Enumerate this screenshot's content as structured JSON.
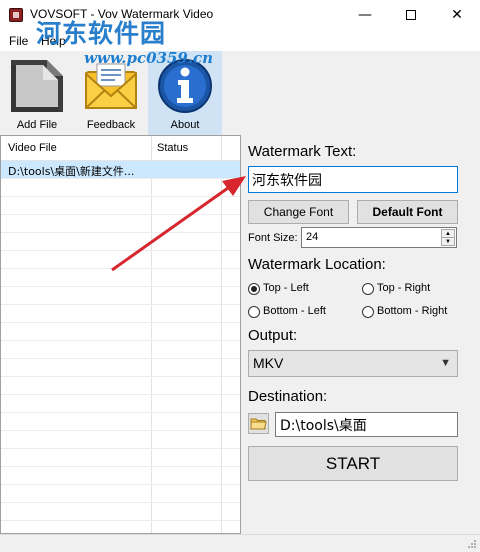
{
  "window": {
    "title": "VOVSOFT - Vov Watermark Video",
    "minimize_glyph": "—",
    "close_glyph": "✕"
  },
  "watermark_overlay": {
    "chinese": "河东软件园",
    "url": "www.pc0359.cn"
  },
  "menu": {
    "file": "File",
    "help": "Help"
  },
  "toolbar": {
    "add_file": "Add File",
    "feedback": "Feedback",
    "about": "About",
    "active": "About"
  },
  "file_list": {
    "columns": [
      "Video File",
      "Status"
    ],
    "rows": [
      {
        "file": "D:\\tools\\桌面\\新建文件...",
        "status": ""
      }
    ]
  },
  "settings": {
    "watermark_text_label": "Watermark Text:",
    "watermark_text_value": "河东软件园",
    "change_font": "Change Font",
    "default_font": "Default Font",
    "font_size_label": "Font Size:",
    "font_size_value": "24",
    "location_label": "Watermark Location:",
    "locations": {
      "top_left": "Top - Left",
      "top_right": "Top - Right",
      "bottom_left": "Bottom - Left",
      "bottom_right": "Bottom - Right"
    },
    "selected_location": "Top - Left",
    "output_label": "Output:",
    "output_value": "MKV",
    "destination_label": "Destination:",
    "destination_value": "D:\\tools\\桌面",
    "start": "START"
  },
  "colors": {
    "accent_border": "#0078d7",
    "selected_row": "#cce8ff",
    "annotation_arrow": "#d8262e",
    "watermark_blue": "#1e79c9"
  }
}
